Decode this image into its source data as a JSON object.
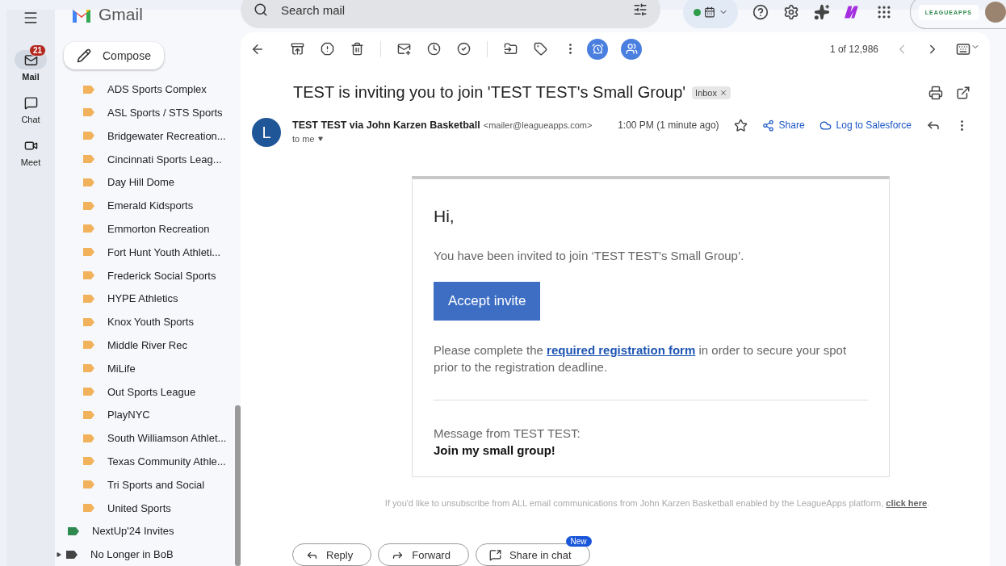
{
  "header": {
    "app_name": "Gmail",
    "search": {
      "placeholder": "Search mail"
    },
    "status_on": true,
    "account_label": "LEAGUEAPPS"
  },
  "rail": [
    {
      "label": "Mail",
      "selected": true,
      "badge": "21"
    },
    {
      "label": "Chat",
      "selected": false
    },
    {
      "label": "Meet",
      "selected": false
    }
  ],
  "compose": "Compose",
  "labels": [
    {
      "name": "ADS Sports Complex",
      "color": "#f2b25c"
    },
    {
      "name": "ASL Sports / STS Sports",
      "color": "#f2b25c"
    },
    {
      "name": "Bridgewater Recreation...",
      "color": "#f2b25c"
    },
    {
      "name": "Cincinnati Sports Leag...",
      "color": "#f2b25c"
    },
    {
      "name": "Day Hill Dome",
      "color": "#f2b25c"
    },
    {
      "name": "Emerald Kidsports",
      "color": "#f2b25c"
    },
    {
      "name": "Emmorton Recreation",
      "color": "#f2b25c"
    },
    {
      "name": "Fort Hunt Youth Athleti...",
      "color": "#f2b25c"
    },
    {
      "name": "Frederick Social Sports",
      "color": "#f2b25c"
    },
    {
      "name": "HYPE Athletics",
      "color": "#f2b25c"
    },
    {
      "name": "Knox Youth Sports",
      "color": "#f2b25c"
    },
    {
      "name": "Middle River Rec",
      "color": "#f2b25c"
    },
    {
      "name": "MiLife",
      "color": "#f2b25c"
    },
    {
      "name": "Out Sports League",
      "color": "#f2b25c"
    },
    {
      "name": "PlayNYC",
      "color": "#f2b25c"
    },
    {
      "name": "South Williamson Athlet...",
      "color": "#f2b25c"
    },
    {
      "name": "Texas Community Athle...",
      "color": "#f2b25c"
    },
    {
      "name": "Tri Sports and Social",
      "color": "#f2b25c"
    },
    {
      "name": "United Sports",
      "color": "#f2b25c"
    },
    {
      "name": "NextUp'24 Invites",
      "color": "#2f8a4f",
      "kind": "top"
    },
    {
      "name": "No Longer in BoB",
      "color": "#444444",
      "kind": "top",
      "expanded": false
    }
  ],
  "toolbar": {
    "counter": "1 of 12,986"
  },
  "email": {
    "subject": "TEST is inviting you to join 'TEST TEST's Small Group'",
    "tag": "Inbox",
    "avatar_letter": "L",
    "sender_name": "TEST TEST via John Karzen Basketball",
    "sender_email": "<mailer@leagueapps.com>",
    "to": "to me",
    "time": "1:00 PM (1 minute ago)",
    "starred": false,
    "actions": [
      "Share",
      "Log to Salesforce"
    ]
  },
  "body": {
    "greeting": "Hi,",
    "intro": "You have been invited to join ‘TEST TEST's Small Group’.",
    "button": "Accept invite",
    "note_before": "Please complete the",
    "note_link": "required registration form",
    "note_after": "in order to secure your spot prior to the registration deadline.",
    "message_label": "Message from TEST TEST:",
    "message": "Join my small group!"
  },
  "footer": {
    "text": "If you'd like to unsubscribe from ALL email communications from John Karzen Basketball enabled by the LeagueApps platform,",
    "link": "click here",
    "end": "."
  },
  "reply_buttons": [
    {
      "label": "Reply",
      "kind": "reply"
    },
    {
      "label": "Forward",
      "kind": "forward"
    },
    {
      "label": "Share in chat",
      "kind": "chat",
      "badge": "New"
    }
  ]
}
